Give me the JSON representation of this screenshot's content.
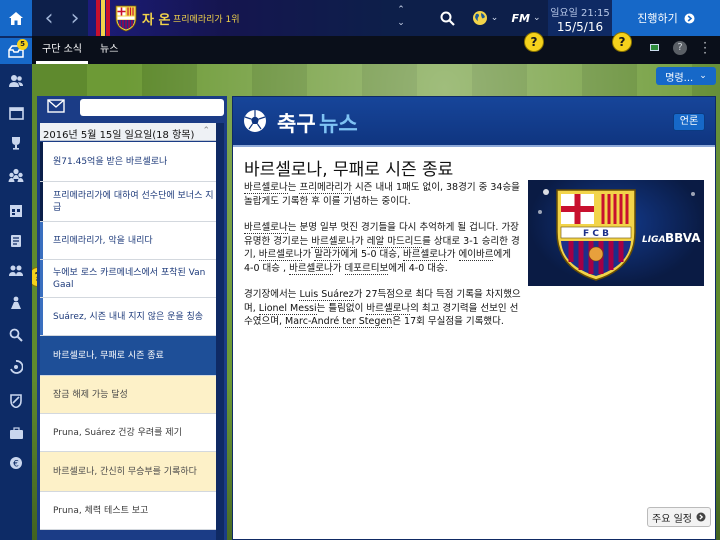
{
  "topbar": {
    "club_name": "자 온",
    "club_position": "프리메라리가 1위",
    "date_time": "일요일 21:15",
    "date_date": "15/5/16",
    "continue_label": "진행하기",
    "fm_label": "FM"
  },
  "subbar": {
    "tabs": [
      {
        "label": "구단 소식",
        "active": true
      },
      {
        "label": "뉴스",
        "active": false
      }
    ],
    "view_label": "명령..."
  },
  "sidebar": {
    "inbox_badge": "5",
    "icons": [
      "inbox-icon",
      "squad-icon",
      "tactics-icon",
      "trophy-icon",
      "staff-icon",
      "schedule-icon",
      "scouting-icon",
      "transfers-icon",
      "training-icon",
      "search-icon",
      "dynamics-icon",
      "club-vision-icon",
      "finances-icon",
      "euro-icon"
    ]
  },
  "help_marker": "?",
  "news_list": {
    "date_header": "2016년 5월 15일 일요일(18 항목)",
    "items": [
      {
        "text": "원71.45억을 받은 바르셀로나",
        "style": "blue"
      },
      {
        "text": "프리메라리가에 대하여 선수단에 보너스 지급",
        "style": "blue"
      },
      {
        "text": "프리메라리가, 악을 내리다",
        "style": "blue"
      },
      {
        "text": "누에보 로스 카르메네스에서 포착된 Van Gaal",
        "style": "blue"
      },
      {
        "text": "Suárez, 시즌 내내 지지 않은 운을 칭송",
        "style": "blue"
      },
      {
        "text": "바르셀로나, 무패로 시즌 종료",
        "style": "selected"
      },
      {
        "text": "잠금 해제 가능 달성",
        "style": "cream"
      },
      {
        "text": "Pruna, Suárez 건강 우려를 제기",
        "style": "plain"
      },
      {
        "text": "바르셀로나, 간신히 무승부를 기록하다",
        "style": "cream"
      },
      {
        "text": "Pruna, 체력 테스트 보고",
        "style": "plain"
      }
    ]
  },
  "article": {
    "title_a": "축구",
    "title_b": "뉴스",
    "language_label": "언론",
    "heading": "바르셀로나, 무패로 시즌 종료",
    "p1": {
      "t1": "바르셀로나",
      "t2": "는 ",
      "t3": "프리메라리가",
      "t4": " 시즌 내내 1패도 없이, 38경기 중 34승을 놀랍게도 기록한 후 이를 기념하는 중이다."
    },
    "p2": {
      "t1": "바르셀로나",
      "t2": "는 분명 일부 멋진 경기들을 다시 추억하게 될 겁니다. 가장 유명한 경기로는 ",
      "t3": "바르셀로나",
      "t4": "가 ",
      "t5": "레알 마드리드",
      "t6": "를 상대로 3-1 승리한 경기, ",
      "t7": "바르셀로나",
      "t8": "가 ",
      "t9": "말라가",
      "t10": "에게 5-0 대승, ",
      "t11": "바르셀로나",
      "t12": "가 ",
      "t13": "에이바르",
      "t14": "에게 4-0 대승 , ",
      "t15": "바르셀로나",
      "t16": "가 ",
      "t17": "데포르티보",
      "t18": "에게 4-0 대승."
    },
    "p3": {
      "t1": "경기장에서는 ",
      "t2": "Luis Suárez",
      "t3": "가 27득점으로 최다 득점 기록을 차지했으며, ",
      "t4": "Lionel Messi",
      "t5": "는 틀림없이 ",
      "t6": "바르셀로나",
      "t7": "의 최고 경기력을 선보인 선수였으며, ",
      "t8": "Marc-André ter Stegen",
      "t9": "은 17회 무실점을 기록했다."
    },
    "image": {
      "crest_letters": "F C B",
      "sponsor_a": "LIGA",
      "sponsor_b": "BBVA"
    },
    "agenda_label": "주요 일정"
  },
  "colors": {
    "accent_blue": "#1668c8",
    "navy": "#0d1f4a",
    "club_yellow": "#f2d44a",
    "help_yellow": "#f5d21c"
  }
}
